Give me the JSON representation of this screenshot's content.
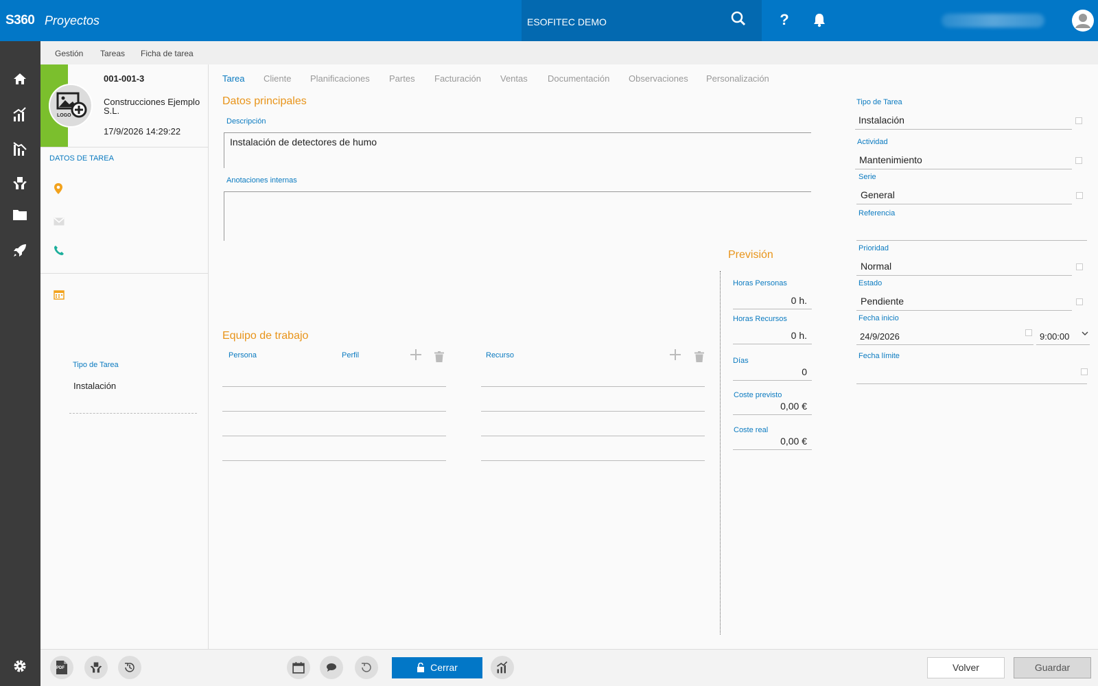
{
  "header": {
    "brand": "S360",
    "module": "Proyectos",
    "company": "ESOFITEC DEMO",
    "icons": [
      "search-icon",
      "help-icon",
      "bell-icon",
      "user-avatar-icon"
    ]
  },
  "rail": {
    "icons": [
      "home-icon",
      "chart-up-icon",
      "chart-down-icon",
      "hands-box-icon",
      "folder-icon",
      "rocket-icon",
      "settings-icon"
    ]
  },
  "breadcrumb": [
    "Gestión",
    "Tareas",
    "Ficha de tarea"
  ],
  "card": {
    "code": "001-001-3",
    "client": "Construcciones Ejemplo S.L.",
    "datetime": "17/9/2026 14:29:22",
    "logo_text": "LOGO",
    "section_label": "DATOS DE TAREA",
    "tipo_label": "Tipo de Tarea",
    "tipo_value": "Instalación"
  },
  "tabs": [
    "Tarea",
    "Cliente",
    "Planificaciones",
    "Partes",
    "Facturación",
    "Ventas",
    "Documentación",
    "Observaciones",
    "Personalización"
  ],
  "main": {
    "datos_title": "Datos principales",
    "descripcion_label": "Descripción",
    "descripcion_value": "Instalación de detectores de humo",
    "anotaciones_label": "Anotaciones internas",
    "anotaciones_value": "",
    "equipo_title": "Equipo de trabajo",
    "persona_label": "Persona",
    "perfil_label": "Perfil",
    "recurso_label": "Recurso"
  },
  "prevision": {
    "title": "Previsión",
    "horas_personas_label": "Horas Personas",
    "horas_personas_value": "0 h.",
    "horas_recursos_label": "Horas Recursos",
    "horas_recursos_value": "0 h.",
    "dias_label": "Días",
    "dias_value": "0",
    "coste_previsto_label": "Coste previsto",
    "coste_previsto_value": "0,00 €",
    "coste_real_label": "Coste real",
    "coste_real_value": "0,00 €"
  },
  "right": {
    "tipo_label": "Tipo de Tarea",
    "tipo_value": "Instalación",
    "actividad_label": "Actividad",
    "actividad_value": "Mantenimiento",
    "serie_label": "Serie",
    "serie_value": "General",
    "referencia_label": "Referencia",
    "referencia_value": "",
    "prioridad_label": "Prioridad",
    "prioridad_value": "Normal",
    "estado_label": "Estado",
    "estado_value": "Pendiente",
    "fecha_inicio_label": "Fecha inicio",
    "fecha_inicio_value": "24/9/2026",
    "hora_inicio_value": "9:00:00",
    "fecha_limite_label": "Fecha límite",
    "fecha_limite_value": ""
  },
  "footer": {
    "cerrar_label": "Cerrar",
    "volver_label": "Volver",
    "guardar_label": "Guardar",
    "pdf_label": "PDF"
  },
  "colors": {
    "primary": "#0277c7",
    "accent": "#e8941a",
    "green": "#7bbf2d",
    "rail": "#3b3b3b"
  }
}
